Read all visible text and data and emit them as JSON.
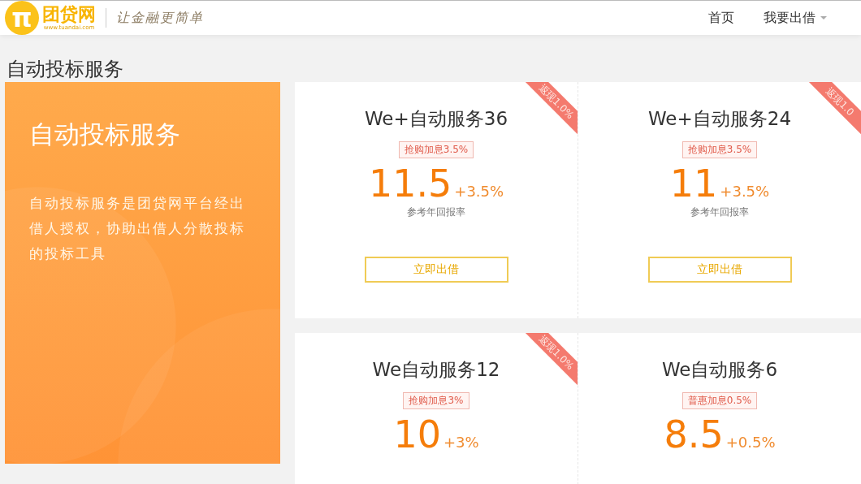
{
  "header": {
    "logo": {
      "mark": "π",
      "name": "团贷网",
      "url": "www.tuandai.com",
      "slogan": "让金融更简单"
    },
    "nav": [
      {
        "label": "首页",
        "dropdown": false
      },
      {
        "label": "我要出借",
        "dropdown": true
      }
    ]
  },
  "page_title": "自动投标服务",
  "intro": {
    "title": "自动投标服务",
    "text": "自动投标服务是团贷网平台经出借人授权，协助出借人分散投标的投标工具"
  },
  "rows": [
    {
      "cards": [
        {
          "ribbon": "返现1.0%",
          "title": "We+自动服务36",
          "tag": "抢购加息3.5%",
          "rate": "11.5",
          "bonus": "+3.5%",
          "rate_label": "参考年回报率",
          "button": "立即出借"
        },
        {
          "ribbon": "返现1.0",
          "title": "We+自动服务24",
          "tag": "抢购加息3.5%",
          "rate": "11",
          "bonus": "+3.5%",
          "rate_label": "参考年回报率",
          "button": "立即出借"
        }
      ]
    },
    {
      "cards": [
        {
          "ribbon": "返现1.0%",
          "title": "We自动服务12",
          "tag": "抢购加息3%",
          "rate": "10",
          "bonus": "+3%"
        },
        {
          "title": "We自动服务6",
          "tag": "普惠加息0.5%",
          "rate": "8.5",
          "bonus": "+0.5%"
        }
      ]
    }
  ]
}
